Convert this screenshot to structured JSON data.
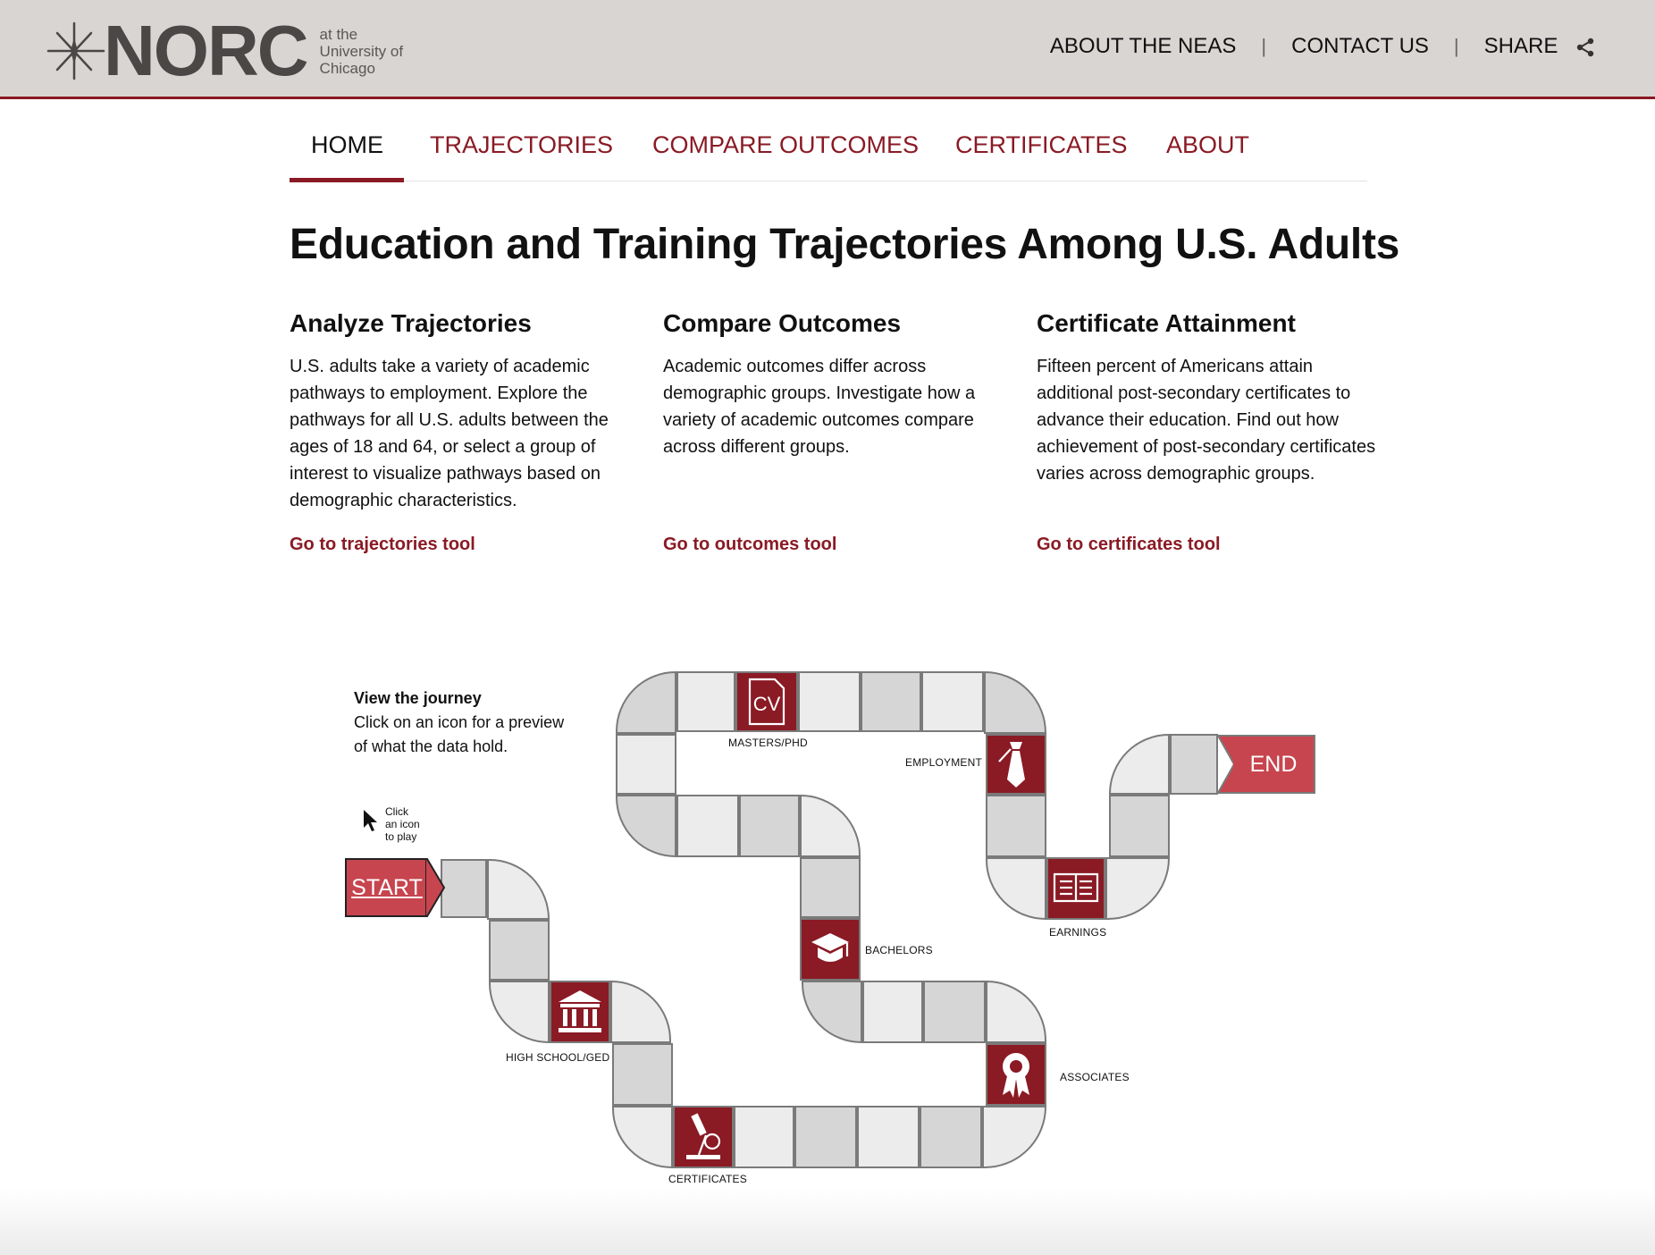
{
  "header": {
    "logo_word": "NORC",
    "logo_sub": [
      "at the",
      "University of",
      "Chicago"
    ],
    "links": [
      "ABOUT THE NEAS",
      "CONTACT US",
      "SHARE"
    ],
    "separator": "|"
  },
  "nav": {
    "tabs": [
      "HOME",
      "TRAJECTORIES",
      "COMPARE OUTCOMES",
      "CERTIFICATES",
      "ABOUT"
    ],
    "active": "HOME"
  },
  "title": "Education and Training Trajectories Among U.S. Adults",
  "columns": [
    {
      "heading": "Analyze Trajectories",
      "body": "U.S. adults take a variety of academic pathways to employment. Explore the pathways for all U.S. adults between the ages of 18 and 64, or select a group of interest to visualize pathways based on demographic characteristics.",
      "link": "Go to trajectories tool"
    },
    {
      "heading": "Compare Outcomes",
      "body": "Academic outcomes differ across demographic groups. Investigate how a variety of academic outcomes compare across different groups.",
      "link": "Go to outcomes tool"
    },
    {
      "heading": "Certificate Attainment",
      "body": "Fifteen percent of Americans attain additional post-secondary certificates to advance their education. Find out how achievement of post-secondary certificates varies across demographic groups.",
      "link": "Go to certificates tool"
    }
  ],
  "journey": {
    "intro_title": "View the journey",
    "intro_lines": [
      "Click on an icon for a preview",
      "of what the data hold."
    ],
    "hint_lines": [
      "Click",
      "an icon",
      "to play"
    ],
    "start": "START",
    "end": "END",
    "steps": {
      "high_school": "HIGH SCHOOL/GED",
      "certificates": "CERTIFICATES",
      "bachelors": "BACHELORS",
      "associates": "ASSOCIATES",
      "masters": "MASTERS/PHD",
      "employment": "EMPLOYMENT",
      "earnings": "EARNINGS"
    },
    "cv_text": "CV"
  },
  "colors": {
    "brand": "#8a1a24",
    "accent": "#c7454f",
    "header_bg": "#d9d5d3"
  },
  "icons": [
    "norc-star-logo",
    "share-icon",
    "cursor-icon",
    "courthouse-icon",
    "microscope-icon",
    "graduation-cap-icon",
    "award-ribbon-icon",
    "cv-document-icon",
    "necktie-icon",
    "open-book-icon"
  ]
}
